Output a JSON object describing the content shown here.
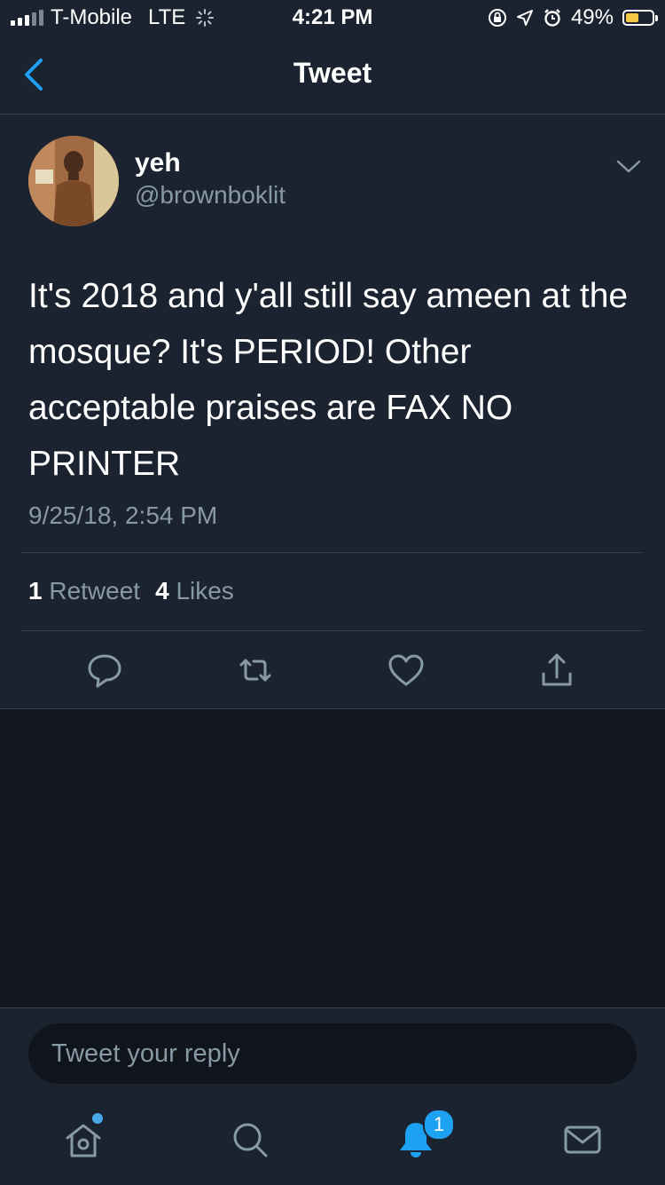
{
  "status_bar": {
    "carrier": "T-Mobile",
    "network": "LTE",
    "time": "4:21 PM",
    "battery_percent": "49%",
    "battery_level": 0.49,
    "icons": [
      "signal-icon",
      "loading-icon",
      "orientation-lock-icon",
      "location-icon",
      "alarm-icon",
      "battery-icon"
    ]
  },
  "nav": {
    "title": "Tweet",
    "back_icon": "back-chevron-icon"
  },
  "tweet": {
    "author_name": "yeh",
    "author_handle": "@brownboklit",
    "text": "It's 2018 and y'all still say ameen at the mosque? It's PERIOD! Other acceptable praises are FAX NO PRINTER",
    "timestamp": "9/25/18, 2:54 PM",
    "retweet_count": "1",
    "retweet_label": "Retweet",
    "like_count": "4",
    "like_label": "Likes",
    "actions": [
      "reply-icon",
      "retweet-icon",
      "like-icon",
      "share-icon"
    ]
  },
  "reply": {
    "placeholder": "Tweet your reply"
  },
  "tabbar": {
    "items": [
      "home-icon",
      "search-icon",
      "notifications-icon",
      "messages-icon"
    ],
    "notification_badge": "1"
  },
  "colors": {
    "background": "#1b2330",
    "accent": "#1da1f2",
    "muted_text": "#8899a6",
    "divider": "#38424f",
    "battery": "#f6c945"
  }
}
